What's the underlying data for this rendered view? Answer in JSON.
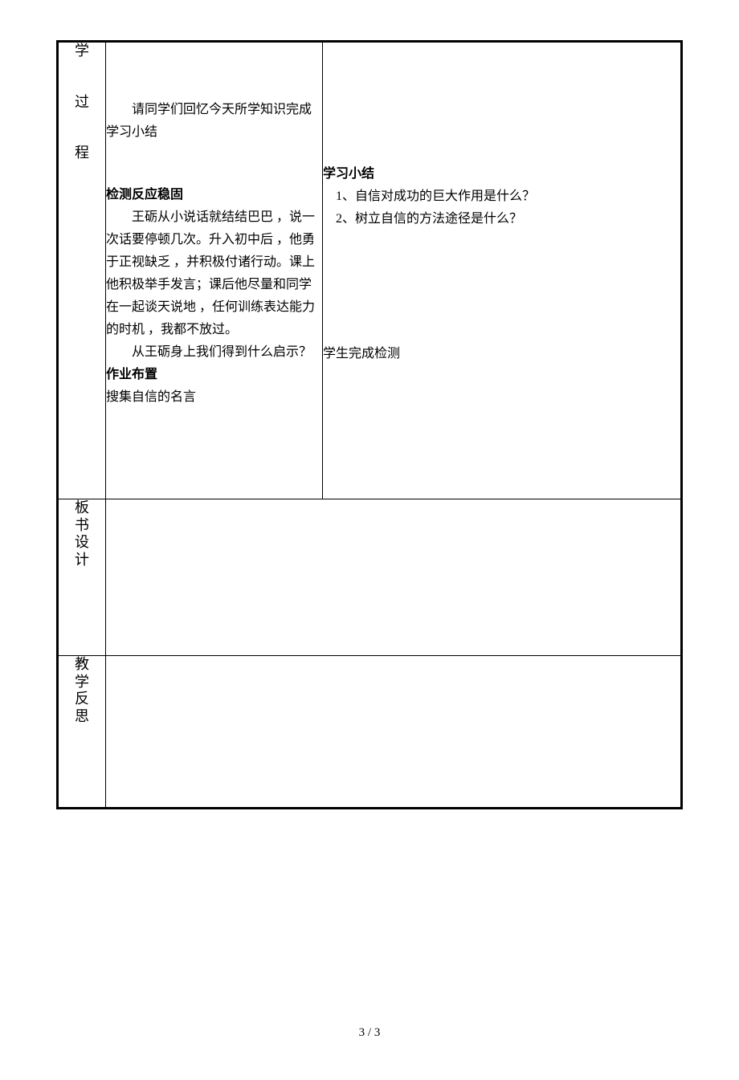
{
  "rows": {
    "process": {
      "label_chars": [
        "学",
        "过",
        "程"
      ],
      "left": {
        "recall_intro": "请同学们回忆今天所学知识完成学习小结",
        "detection_title": "检测反应稳固",
        "detection_body_1": "王砺从小说话就结结巴巴 ，说一次话要停顿几次。升入初中后 ，他勇于正视缺乏 ，并积极付诸行动。课上他积极举手发言；课后他尽量和同学在一起谈天说地 ，任何训练表达能力的时机 ，我都不放过。",
        "detection_body_2": "从王砺身上我们得到什么启示？",
        "homework_title": "作业布置",
        "homework_body": "搜集自信的名言"
      },
      "right": {
        "summary_title": "学习小结",
        "summary_items": [
          "1、自信对成功的巨大作用是什么？",
          "2、树立自信的方法途径是什么？"
        ],
        "complete_detection": "学生完成检测"
      }
    },
    "board": {
      "label_chars": [
        "板",
        "书",
        "设",
        "计"
      ]
    },
    "reflection": {
      "label_chars": [
        "教",
        "学",
        "反",
        "思"
      ]
    }
  },
  "page_number": "3 / 3"
}
